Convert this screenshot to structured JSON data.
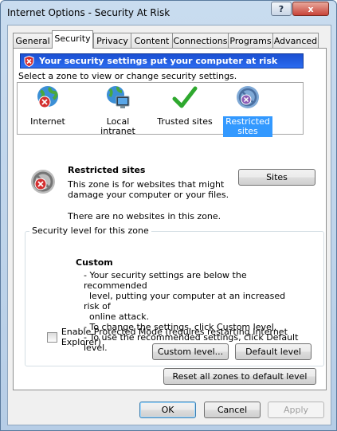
{
  "window": {
    "title": "Internet Options - Security At Risk",
    "help_label": "?",
    "close_label": "x"
  },
  "tabs": [
    {
      "label": "General"
    },
    {
      "label": "Security"
    },
    {
      "label": "Privacy"
    },
    {
      "label": "Content"
    },
    {
      "label": "Connections"
    },
    {
      "label": "Programs"
    },
    {
      "label": "Advanced"
    }
  ],
  "active_tab": "Security",
  "banner": {
    "text": "Your security settings put your computer at risk",
    "icon": "shield-warning-icon"
  },
  "zone_select_label": "Select a zone to view or change security settings.",
  "zones": [
    {
      "label": "Internet",
      "icon": "globe-warning-icon"
    },
    {
      "label": "Local intranet",
      "icon": "intranet-icon"
    },
    {
      "label": "Trusted sites",
      "icon": "checkmark-icon"
    },
    {
      "label": "Restricted sites",
      "icon": "restricted-icon",
      "selected": true
    }
  ],
  "zone_info": {
    "title": "Restricted sites",
    "description": "This zone is for websites that might damage your computer or your files.",
    "empty_note": "There are no websites in this zone.",
    "sites_button": "Sites"
  },
  "security_level": {
    "group_label": "Security level for this zone",
    "level_name": "Custom",
    "lines": [
      "- Your security settings are below the recommended",
      "  level, putting your computer at an increased risk of",
      "  online attack.",
      "- To change the settings, click Custom level.",
      "- To use the recommended settings, click Default level."
    ],
    "protected_mode_label": "Enable Protected Mode (requires restarting Internet Explorer)",
    "protected_mode_checked": false,
    "custom_level_button": "Custom level...",
    "default_level_button": "Default level"
  },
  "reset_button": "Reset all zones to default level",
  "dialog_buttons": {
    "ok": "OK",
    "cancel": "Cancel",
    "apply": "Apply"
  },
  "colors": {
    "banner_blue": "#1b4fd1",
    "selection_blue": "#3399ff",
    "warning_red": "#c62828",
    "check_green": "#2ea82e"
  }
}
